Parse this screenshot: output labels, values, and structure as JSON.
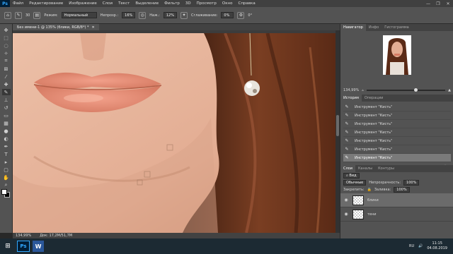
{
  "menubar": {
    "logo": "Ps",
    "items": [
      "Файл",
      "Редактирование",
      "Изображение",
      "Слои",
      "Текст",
      "Выделение",
      "Фильтр",
      "3D",
      "Просмотр",
      "Окно",
      "Справка"
    ],
    "controls": [
      "—",
      "❐",
      "✕"
    ]
  },
  "options": {
    "mode_label": "Режим:",
    "mode_value": "Нормальный",
    "opacity_label": "Непрозр.:",
    "opacity_value": "16%",
    "pressure_label": "Наж.:",
    "pressure_value": "12%",
    "smoothing_label": "Сглаживание:",
    "smoothing_value": "0%",
    "brush_size": "30",
    "angle_value": "0°"
  },
  "document": {
    "tab_title": "Без имени-1 @ 135% (блики, RGB/8*) *",
    "close": "✕"
  },
  "status": {
    "zoom": "134,99%",
    "doc_info": "Док: 17,2М/51,7М"
  },
  "navigator": {
    "tabs": [
      "Навигатор",
      "Инфо",
      "Гистограмма"
    ],
    "zoom": "134,99%"
  },
  "history": {
    "tabs": [
      "История",
      "Операции"
    ],
    "items": [
      "Инструмент \"Кисть\"",
      "Инструмент \"Кисть\"",
      "Инструмент \"Кисть\"",
      "Инструмент \"Кисть\"",
      "Инструмент \"Кисть\"",
      "Инструмент \"Кисть\"",
      "Инструмент \"Кисть\""
    ]
  },
  "layers": {
    "tabs": [
      "Слои",
      "Каналы",
      "Контуры"
    ],
    "kind": "Вид",
    "blend": "Обычные",
    "opacity_label": "Непрозрачность:",
    "opacity_value": "100%",
    "lock_label": "Закрепить:",
    "fill_label": "Заливка:",
    "fill_value": "100%",
    "items": [
      {
        "name": "блики",
        "selected": true
      },
      {
        "name": "тени",
        "selected": false
      }
    ]
  },
  "taskbar": {
    "lang": "RU",
    "time": "11:15",
    "date": "04.08.2019"
  },
  "colors": {
    "accent": "#31a8ff",
    "panel": "#535353"
  }
}
